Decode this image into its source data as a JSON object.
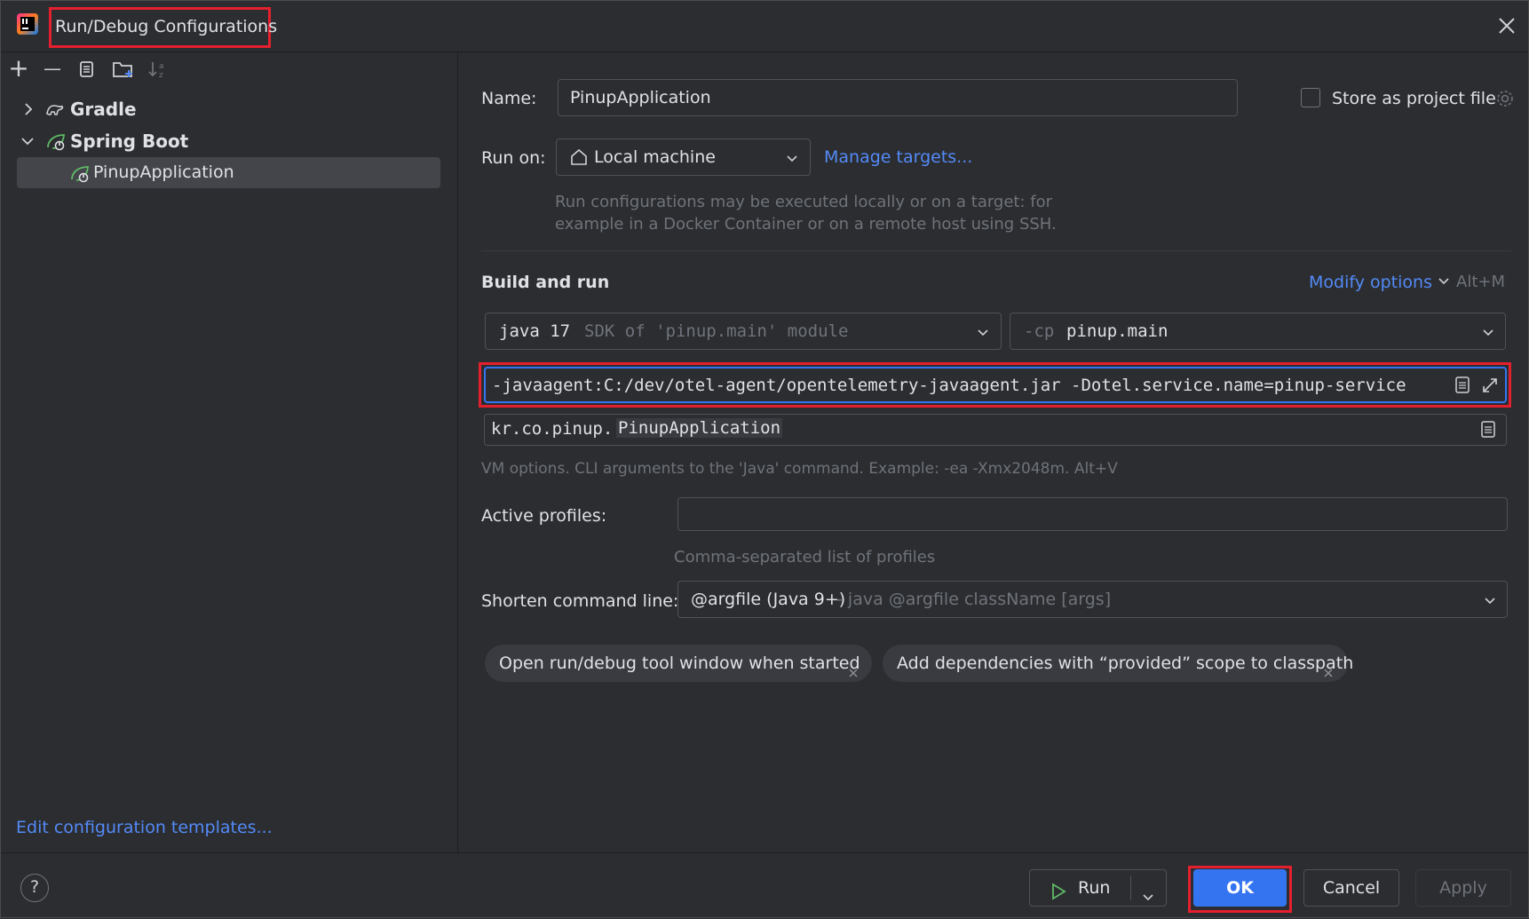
{
  "window": {
    "title": "Run/Debug Configurations"
  },
  "toolbar": {
    "add": "+",
    "remove": "—"
  },
  "tree": {
    "groups": [
      {
        "label": "Gradle",
        "expanded": false
      },
      {
        "label": "Spring Boot",
        "expanded": true
      }
    ],
    "selected_item": "PinupApplication"
  },
  "left_footer": {
    "edit_templates": "Edit configuration templates..."
  },
  "form": {
    "name_label": "Name:",
    "name_value": "PinupApplication",
    "store_as_project_file": "Store as project file",
    "store_checked": false,
    "run_on_label": "Run on:",
    "run_on_value": "Local machine",
    "manage_targets": "Manage targets...",
    "run_on_hint_1": "Run configurations may be executed locally or on a target: for",
    "run_on_hint_2": "example in a Docker Container or on a remote host using SSH.",
    "build_and_run": "Build and run",
    "modify_options": "Modify options",
    "modify_shortcut": "Alt+M",
    "jdk_main": "java 17",
    "jdk_detail": "SDK of 'pinup.main' module",
    "cp_prefix": "-cp",
    "cp_value": "pinup.main",
    "vm_options": "-javaagent:C:/dev/otel-agent/opentelemetry-javaagent.jar -Dotel.service.name=pinup-service",
    "main_class_pkg": "kr.co.pinup.",
    "main_class_name": "PinupApplication",
    "vm_hint": "VM options. CLI arguments to the 'Java' command. Example: -ea -Xmx2048m. Alt+V",
    "active_profiles_label": "Active profiles:",
    "active_profiles_value": "",
    "profiles_hint": "Comma-separated list of profiles",
    "shorten_label": "Shorten command line:",
    "shorten_value": "@argfile (Java 9+)",
    "shorten_detail": " - java @argfile className [args]",
    "chips": [
      "Open run/debug tool window when started",
      "Add dependencies with “provided” scope to classpath"
    ]
  },
  "footer": {
    "help": "?",
    "run": "Run",
    "ok": "OK",
    "cancel": "Cancel",
    "apply": "Apply"
  },
  "colors": {
    "background": "#2b2d30",
    "accent": "#3574f0",
    "link": "#548af7",
    "highlight_red": "#e5202e",
    "spring_green": "#5fb865"
  }
}
